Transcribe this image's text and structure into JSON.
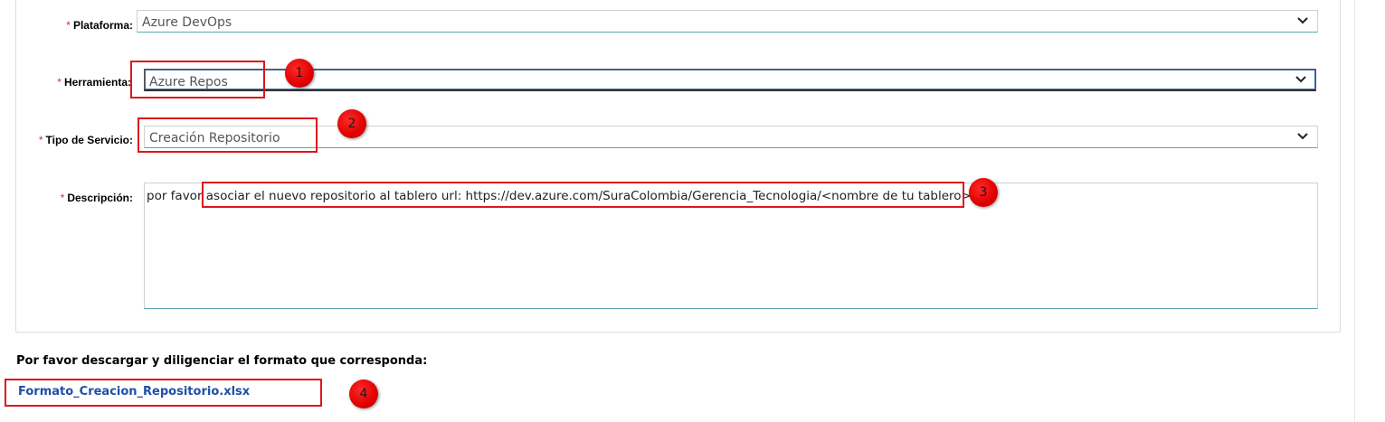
{
  "form": {
    "required_mark": "*",
    "plataforma": {
      "label": "Plataforma:",
      "value": "Azure DevOps"
    },
    "herramienta": {
      "label": "Herramienta:",
      "value": "Azure Repos"
    },
    "tipo_servicio": {
      "label": "Tipo de Servicio:",
      "value": "Creación Repositorio"
    },
    "descripcion": {
      "label": "Descripción:",
      "value": "por favor asociar el nuevo repositorio al tablero url: https://dev.azure.com/SuraColombia/Gerencia_Tecnologia/<nombre de tu tablero>"
    }
  },
  "download": {
    "instruction": "Por favor descargar y diligenciar el formato que corresponda:",
    "file_link": "Formato_Creacion_Repositorio.xlsx"
  },
  "annotations": {
    "badges": [
      "1",
      "2",
      "3",
      "4"
    ],
    "color": "#e0141e"
  },
  "icons": {
    "dropdown": "chevron-down-icon"
  }
}
